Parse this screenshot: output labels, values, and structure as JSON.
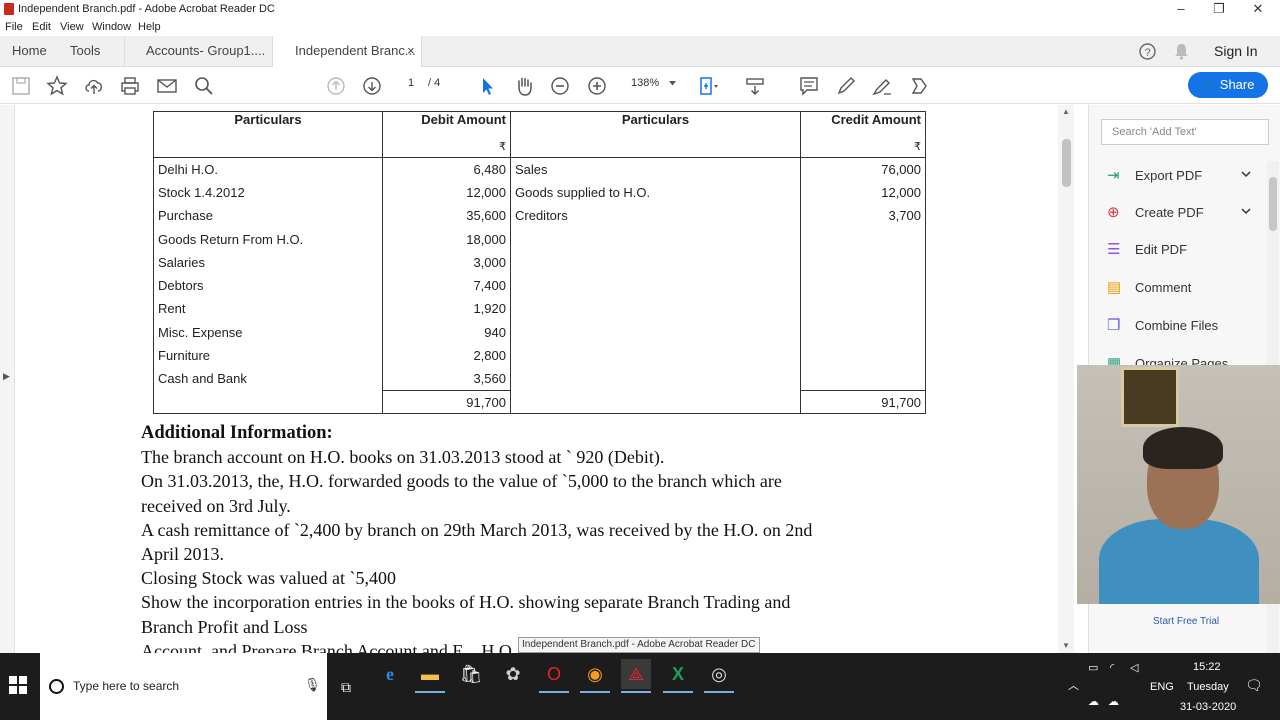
{
  "window": {
    "title": "Independent Branch.pdf - Adobe Acrobat Reader DC",
    "minimize_glyph": "–",
    "maximize_glyph": "❐",
    "close_glyph": "✕"
  },
  "menu": [
    "File",
    "Edit",
    "View",
    "Window",
    "Help"
  ],
  "tabs": {
    "home": "Home",
    "tools": "Tools",
    "doc1": "Accounts- Group1....",
    "doc2": "Independent Branc...",
    "doc2_close": "×",
    "sign_in": "Sign In"
  },
  "toolbar": {
    "page_current": "1",
    "page_total": "/ 4",
    "zoom": "138%",
    "share": "Share"
  },
  "icons": {
    "save": "save-icon",
    "bookmark": "star-icon",
    "upload": "upload-icon",
    "print": "print-icon",
    "email": "mail-icon",
    "search": "search-icon",
    "page_up": "arrow-up-icon",
    "page_down": "arrow-down-icon",
    "select": "pointer-icon",
    "hand": "hand-icon",
    "zoom_out": "minus-circle-icon",
    "zoom_in": "plus-circle-icon"
  },
  "ledger": {
    "headers": [
      "Particulars",
      "Debit Amount",
      "Particulars",
      "Credit Amount"
    ],
    "currency_symbol": "₹",
    "rows": [
      {
        "dp": "Delhi H.O.",
        "da": "6,480",
        "cp": "Sales",
        "ca": "76,000"
      },
      {
        "dp": "Stock 1.4.2012",
        "da": "12,000",
        "cp": "Goods supplied to H.O.",
        "ca": "12,000"
      },
      {
        "dp": "Purchase",
        "da": "35,600",
        "cp": "Creditors",
        "ca": "3,700"
      },
      {
        "dp": "Goods Return From H.O.",
        "da": "18,000",
        "cp": "",
        "ca": ""
      },
      {
        "dp": "Salaries",
        "da": "3,000",
        "cp": "",
        "ca": ""
      },
      {
        "dp": "Debtors",
        "da": "7,400",
        "cp": "",
        "ca": ""
      },
      {
        "dp": "Rent",
        "da": "1,920",
        "cp": "",
        "ca": ""
      },
      {
        "dp": "Misc. Expense",
        "da": "940",
        "cp": "",
        "ca": ""
      },
      {
        "dp": "Furniture",
        "da": "2,800",
        "cp": "",
        "ca": ""
      },
      {
        "dp": "Cash and Bank",
        "da": "3,560",
        "cp": "",
        "ca": ""
      }
    ],
    "total_debit": "91,700",
    "total_credit": "91,700"
  },
  "additional": {
    "heading": "Additional Information:",
    "lines": [
      "The branch account on H.O. books on 31.03.2013 stood at ` 920 (Debit).",
      "On 31.03.2013, the, H.O. forwarded goods to the value of `5,000 to the branch which are",
      "received on 3rd July.",
      "A cash remittance of `2,400 by branch on 29th March 2013, was received by the H.O. on 2nd",
      "April 2013.",
      "Closing Stock was valued at `5,400",
      "Show the incorporation entries in the books of H.O. showing separate Branch Trading and",
      "Branch Profit and Loss",
      "Account, and Prepare Branch Account and E...                H.O. books."
    ]
  },
  "tooltip": "Independent Branch.pdf - Adobe Acrobat Reader DC",
  "right_panel": {
    "search_placeholder": "Search 'Add Text'",
    "tools": [
      "Export PDF",
      "Create PDF",
      "Edit PDF",
      "Comment",
      "Combine Files",
      "Organize Pages"
    ],
    "start_trial": "Start Free Trial"
  },
  "taskbar": {
    "search_placeholder": "Type here to search",
    "lang": "ENG",
    "time": "15:22",
    "day": "Tuesday",
    "date": "31-03-2020"
  }
}
